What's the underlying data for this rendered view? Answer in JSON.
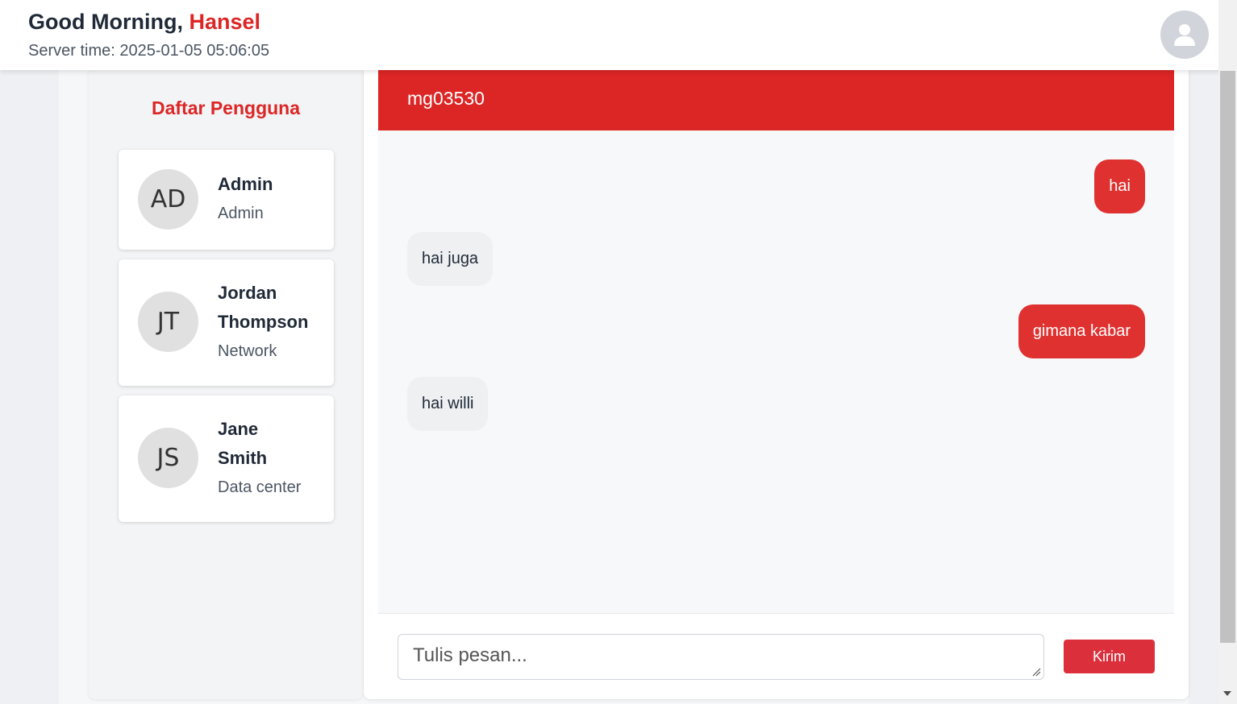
{
  "header": {
    "greeting_prefix": "Good Morning, ",
    "user_name": "Hansel",
    "server_time": "Server time: 2025-01-05 05:06:05",
    "avatar_icon": "user-icon"
  },
  "sidebar": {
    "title": "Daftar Pengguna",
    "users": [
      {
        "initials": "AD",
        "name": "Admin",
        "role": "Admin"
      },
      {
        "initials": "JT",
        "name_line1": "Jordan",
        "name_line2": "Thompson",
        "role": "Network"
      },
      {
        "initials": "JS",
        "name_line1": "Jane",
        "name_line2": "Smith",
        "role": "Data center"
      }
    ]
  },
  "chat": {
    "title": "mg03530",
    "messages": [
      {
        "text": "hai",
        "direction": "out"
      },
      {
        "text": "hai juga",
        "direction": "in"
      },
      {
        "text": "gimana kabar",
        "direction": "out"
      },
      {
        "text": "hai willi",
        "direction": "in"
      }
    ],
    "input_placeholder": "Tulis pesan...",
    "send_label": "Kirim"
  },
  "colors": {
    "accent": "#dc2626",
    "outgoing_bubble": "#e03131",
    "incoming_bubble": "#eef0f2"
  }
}
